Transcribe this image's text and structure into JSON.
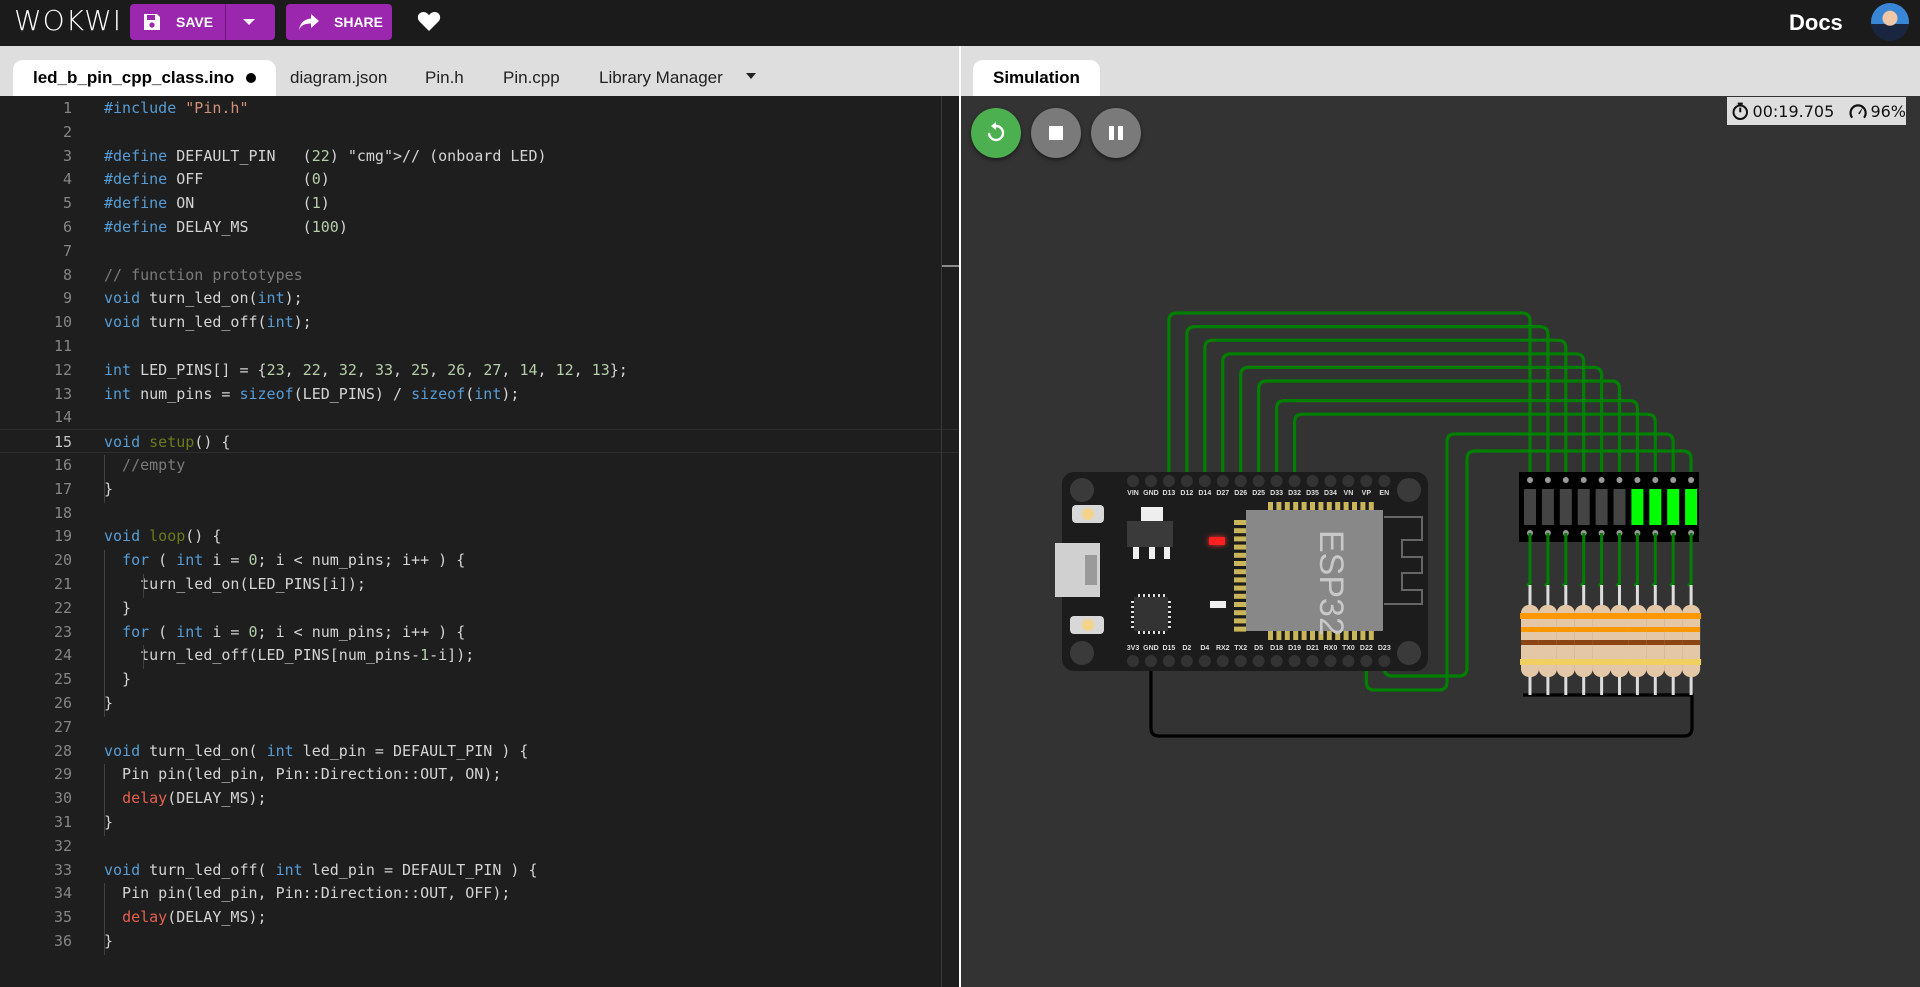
{
  "app": {
    "logo": "WOKWI",
    "save_label": "SAVE",
    "share_label": "SHARE",
    "docs_label": "Docs"
  },
  "editor_tabs": [
    {
      "label": "led_b_pin_cpp_class.ino",
      "active": true,
      "unsaved": true
    },
    {
      "label": "diagram.json"
    },
    {
      "label": "Pin.h"
    },
    {
      "label": "Pin.cpp"
    },
    {
      "label": "Library Manager"
    }
  ],
  "sim_tabs": [
    {
      "label": "Simulation",
      "active": true
    }
  ],
  "status": {
    "elapsed_time": "00:19.705",
    "speed": "96%"
  },
  "editor": {
    "current_line": 15,
    "lines": [
      "#include \"Pin.h\"",
      "",
      "#define DEFAULT_PIN   (22) // (onboard LED)",
      "#define OFF           (0)",
      "#define ON            (1)",
      "#define DELAY_MS      (100)",
      "",
      "// function prototypes",
      "void turn_led_on(int);",
      "void turn_led_off(int);",
      "",
      "int LED_PINS[] = {23, 22, 32, 33, 25, 26, 27, 14, 12, 13};",
      "int num_pins = sizeof(LED_PINS) / sizeof(int);",
      "",
      "void setup() {",
      "  //empty",
      "}",
      "",
      "void loop() {",
      "  for ( int i = 0; i < num_pins; i++ ) {",
      "    turn_led_on(LED_PINS[i]);",
      "  }",
      "  for ( int i = 0; i < num_pins; i++ ) {",
      "    turn_led_off(LED_PINS[num_pins-1-i]);",
      "  }",
      "}",
      "",
      "void turn_led_on( int led_pin = DEFAULT_PIN ) {",
      "  Pin pin(led_pin, Pin::Direction::OUT, ON);",
      "  delay(DELAY_MS);",
      "}",
      "",
      "void turn_led_off( int led_pin = DEFAULT_PIN ) {",
      "  Pin pin(led_pin, Pin::Direction::OUT, OFF);",
      "  delay(DELAY_MS);",
      "}"
    ]
  },
  "board": {
    "chip_label": "ESP32",
    "top_pins": [
      "VIN",
      "GND",
      "D13",
      "D12",
      "D14",
      "D27",
      "D26",
      "D25",
      "D33",
      "D32",
      "D35",
      "D34",
      "VN",
      "VP",
      "EN"
    ],
    "bottom_pins": [
      "3V3",
      "GND",
      "D15",
      "D2",
      "D4",
      "RX2",
      "TX2",
      "D5",
      "D18",
      "D19",
      "D21",
      "RX0",
      "TX0",
      "D22",
      "D23"
    ],
    "power_led_color": "#ff2020"
  },
  "led_bar": {
    "segments": 10,
    "lit": [
      false,
      false,
      false,
      false,
      false,
      false,
      true,
      true,
      true,
      true
    ],
    "on_color": "#00ff00",
    "off_color": "#444444"
  },
  "resistors": {
    "count": 10,
    "bands": [
      "#ff9800",
      "#ff9800",
      "#8b4513",
      "#f0d060"
    ]
  },
  "wires": {
    "signal_color": "#008000",
    "ground_color": "#000000"
  }
}
